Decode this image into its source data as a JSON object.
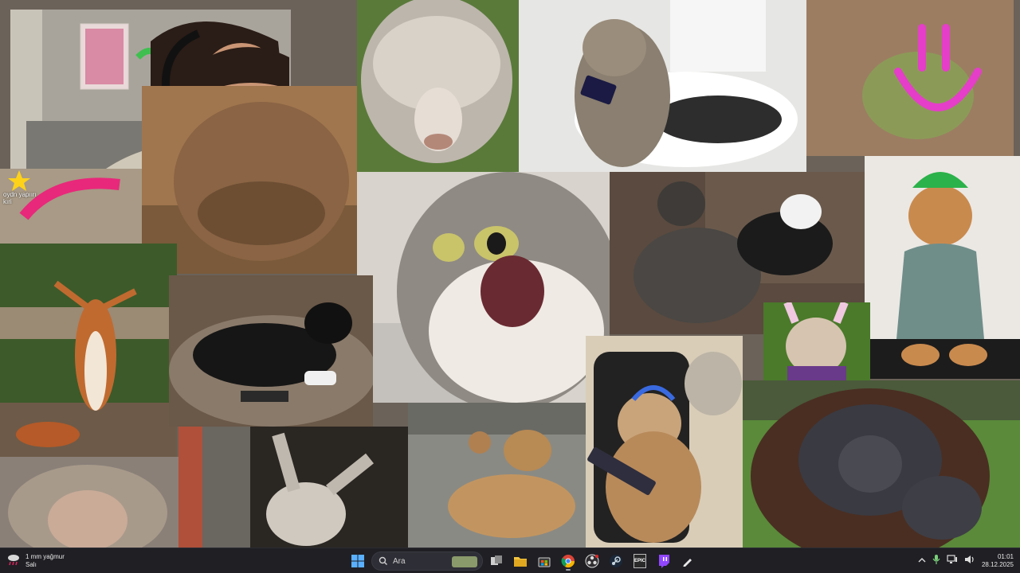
{
  "desktop": {
    "tiles": [
      {
        "name": "streamer-webcam-tile"
      },
      {
        "name": "brown-dog-tile"
      },
      {
        "name": "sheep-tile"
      },
      {
        "name": "cat-on-toilet-tile"
      },
      {
        "name": "frog-tile"
      },
      {
        "name": "pink-sticker-tile"
      },
      {
        "name": "shocked-cat-tile"
      },
      {
        "name": "dog-fight-tile"
      },
      {
        "name": "cat-in-green-hat-tile"
      },
      {
        "name": "squirrel-tile"
      },
      {
        "name": "black-dog-gamer-tile"
      },
      {
        "name": "bulldog-bunny-ears-tile"
      },
      {
        "name": "gamer-cat-tile"
      },
      {
        "name": "orangutan-tile"
      },
      {
        "name": "monkey-tile"
      },
      {
        "name": "donkey-tile"
      },
      {
        "name": "dogs-street-tile"
      }
    ],
    "sticker_text": "oydn yapıırı\nkıri"
  },
  "taskbar": {
    "weather": {
      "temperature_text": "1 mm yağmur",
      "day": "Salı"
    },
    "search": {
      "placeholder": "Ara"
    },
    "apps": [
      {
        "name": "start-button",
        "icon": "windows-icon"
      },
      {
        "name": "search-box",
        "icon": "search-icon"
      },
      {
        "name": "task-view-button",
        "icon": "task-view-icon"
      },
      {
        "name": "file-explorer-button",
        "icon": "folder-icon"
      },
      {
        "name": "microsoft-store-button",
        "icon": "store-icon"
      },
      {
        "name": "chrome-button",
        "icon": "chrome-icon"
      },
      {
        "name": "obs-button",
        "icon": "obs-icon"
      },
      {
        "name": "steam-button",
        "icon": "steam-icon"
      },
      {
        "name": "epic-games-button",
        "icon": "epic-icon",
        "label": "EPIC"
      },
      {
        "name": "twitch-button",
        "icon": "twitch-icon"
      },
      {
        "name": "pen-button",
        "icon": "pen-icon"
      }
    ],
    "clock": {
      "time": "01:01",
      "date": "28.12.2025"
    },
    "colors": {
      "taskbar_bg": "#1f1f24",
      "chrome_red": "#db4437",
      "folder": "#f4c542",
      "twitch": "#9146ff"
    }
  }
}
